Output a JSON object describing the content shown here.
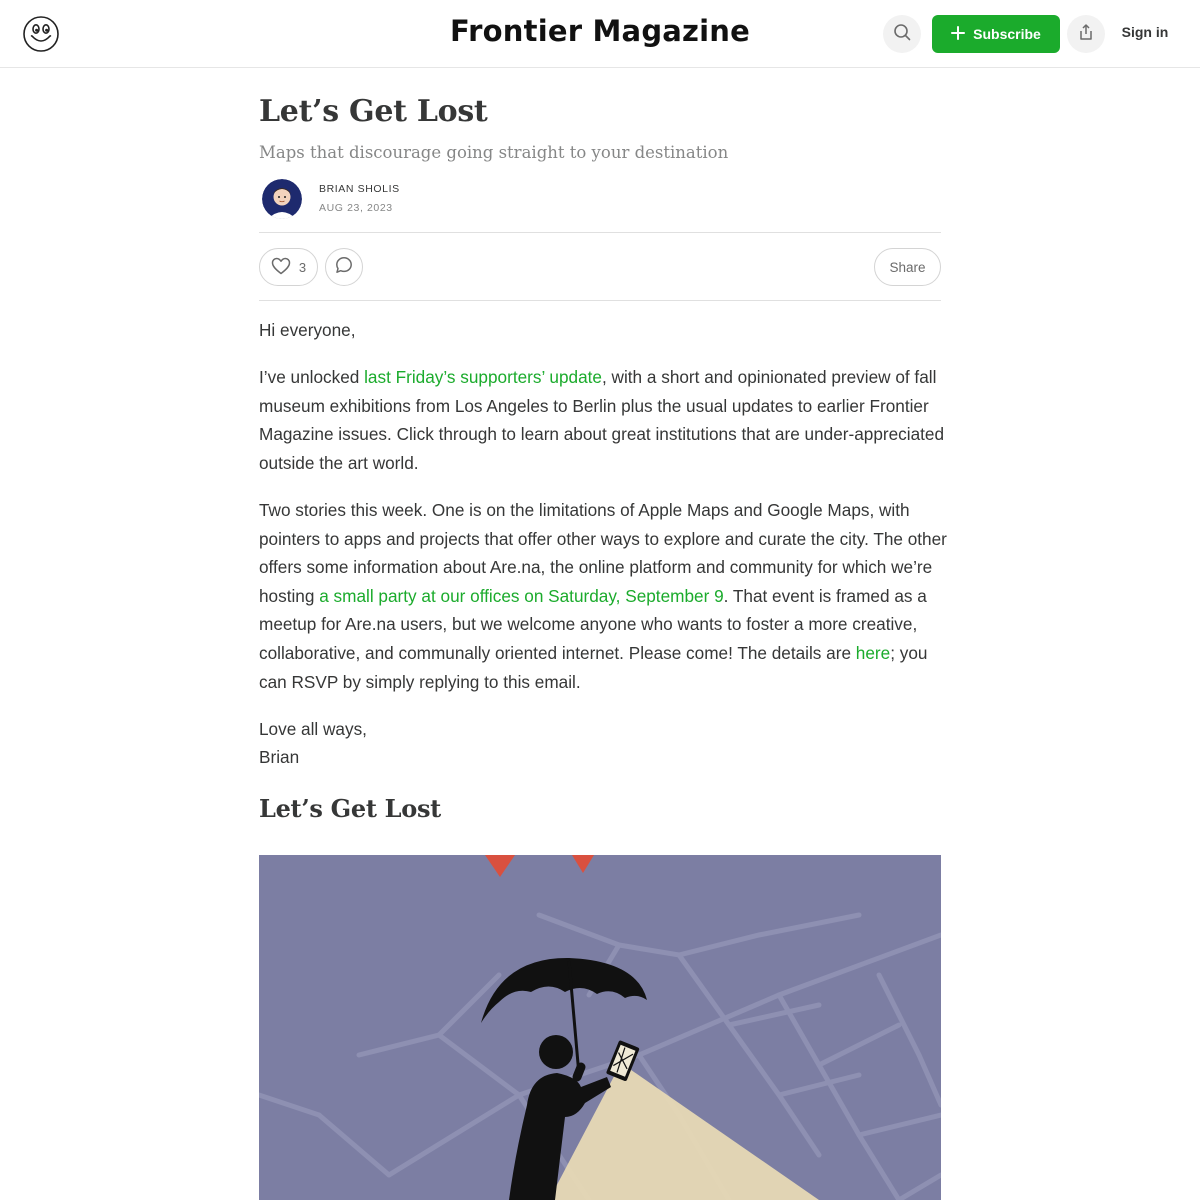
{
  "header": {
    "publication_title": "Frontier Magazine",
    "subscribe_label": "Subscribe",
    "signin_label": "Sign in"
  },
  "post": {
    "title": "Let’s Get Lost",
    "subtitle": "Maps that discourage going straight to your destination",
    "author": "BRIAN SHOLIS",
    "date": "AUG 23, 2023",
    "like_count": "3",
    "share_label": "Share"
  },
  "body": {
    "greeting": "Hi everyone,",
    "p1_pre": "I’ve unlocked ",
    "p1_link": "last Friday’s supporters’ update",
    "p1_post": ", with a short and opinionated preview of fall museum exhibitions from Los Angeles to Berlin plus the usual updates to earlier Frontier Magazine issues. Click through to learn about great institutions that are under-appreciated outside the art world.",
    "p2_pre": "Two stories this week. One is on the limitations of Apple Maps and Google Maps, with pointers to apps and projects that offer other ways to explore and curate the city. The other offers some information about Are.na, the online platform and community for which we’re hosting ",
    "p2_link1": "a small party at our offices on Saturday, September 9",
    "p2_mid": ". That event is framed as a meetup for Are.na users, but we welcome anyone who wants to foster a more creative, collaborative, and communally oriented internet. Please come! The details are ",
    "p2_link2": "here",
    "p2_post": "; you can RSVP by simply replying to this email.",
    "signoff_1": "Love all ways,",
    "signoff_2": "Brian",
    "section_heading": "Let’s Get Lost"
  },
  "colors": {
    "accent": "#1bab2c",
    "text": "#363737",
    "muted": "#868787",
    "illustration_bg": "#7c7ea3",
    "light_cone": "#e9dbb5"
  },
  "icons": [
    "smiley-logo-icon",
    "search-icon",
    "plus-icon",
    "upload-icon",
    "heart-icon",
    "comment-icon"
  ]
}
